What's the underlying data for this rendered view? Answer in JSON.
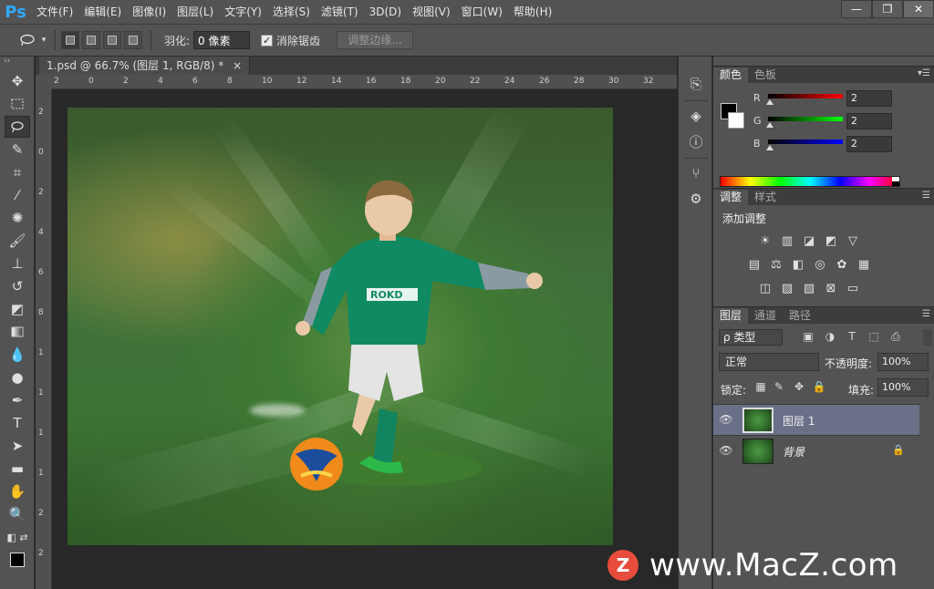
{
  "app": {
    "logo": "Ps"
  },
  "menu": [
    "文件(F)",
    "编辑(E)",
    "图像(I)",
    "图层(L)",
    "文字(Y)",
    "选择(S)",
    "滤镜(T)",
    "3D(D)",
    "视图(V)",
    "窗口(W)",
    "帮助(H)"
  ],
  "window_controls": {
    "minimize": "—",
    "restore": "❐",
    "close": "✕"
  },
  "options": {
    "tool_icon": "lasso-icon",
    "feather_label": "羽化:",
    "feather_value": "0 像素",
    "antialias_label": "消除锯齿",
    "antialias_checked": true,
    "refine_edge_label": "调整边缘..."
  },
  "document": {
    "tab_title": "1.psd @ 66.7% (图层 1, RGB/8) *",
    "tab_close": "×",
    "ruler_h": [
      "2",
      "0",
      "2",
      "4",
      "6",
      "8",
      "10",
      "12",
      "14",
      "16",
      "18",
      "20",
      "22",
      "24",
      "26",
      "28",
      "30",
      "32"
    ],
    "ruler_v": [
      "2",
      "0",
      "2",
      "4",
      "6",
      "8",
      "1",
      "1",
      "1",
      "1",
      "2",
      "2"
    ]
  },
  "panels": {
    "color": {
      "tabs": [
        "颜色",
        "色板"
      ],
      "r_label": "R",
      "g_label": "G",
      "b_label": "B",
      "r_value": "2",
      "g_value": "2",
      "b_value": "2"
    },
    "adjustments": {
      "tabs": [
        "调整",
        "样式"
      ],
      "title": "添加调整"
    },
    "layers": {
      "tabs": [
        "图层",
        "通道",
        "路径"
      ],
      "filter_label": "ρ 类型",
      "blend_mode": "正常",
      "opacity_label": "不透明度:",
      "opacity_value": "100%",
      "lock_label": "锁定:",
      "fill_label": "填充:",
      "fill_value": "100%",
      "items": [
        {
          "name": "图层 1",
          "selected": true,
          "locked": false
        },
        {
          "name": "背景",
          "selected": false,
          "locked": true
        }
      ]
    }
  },
  "watermark": {
    "logo": "Z",
    "text": "www.MacZ.com"
  }
}
